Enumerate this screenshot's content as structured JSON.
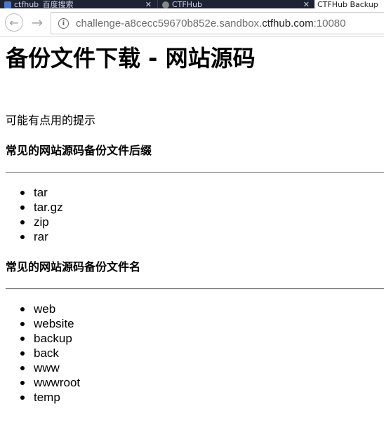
{
  "browser": {
    "tabs": [
      {
        "label": "ctfhub_百度搜索"
      },
      {
        "label": "CTFHub"
      },
      {
        "label": "CTFHub Backup"
      }
    ],
    "url_prefix": "challenge-a8cecc59670b852e.sandbox.",
    "url_domain": "ctfhub.com",
    "url_suffix": ":10080"
  },
  "page": {
    "title": "备份文件下载 - 网站源码",
    "hint": "可能有点用的提示",
    "section1": {
      "title": "常见的网站源码备份文件后缀",
      "items": [
        "tar",
        "tar.gz",
        "zip",
        "rar"
      ]
    },
    "section2": {
      "title": "常见的网站源码备份文件名",
      "items": [
        "web",
        "website",
        "backup",
        "back",
        "www",
        "wwwroot",
        "temp"
      ]
    }
  }
}
